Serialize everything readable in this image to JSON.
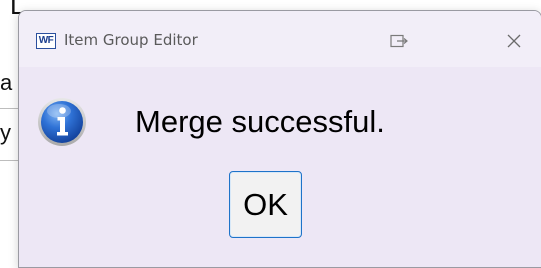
{
  "background_window": {
    "fragments": [
      "L ...iie",
      "a",
      "y"
    ]
  },
  "dialog": {
    "app_icon_text": "WF",
    "title": "Item Group Editor",
    "message": "Merge successful.",
    "ok_label": "OK",
    "icon": "info-icon"
  },
  "colors": {
    "dialog_bg": "#ede7f5",
    "titlebar_bg": "#f2eef8",
    "button_border": "#1e73c9",
    "info_blue": "#1b5fc4"
  }
}
